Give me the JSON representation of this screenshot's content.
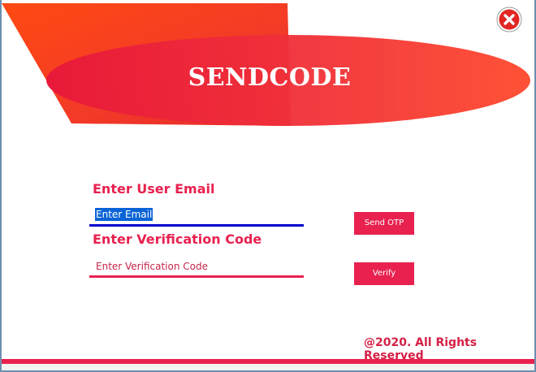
{
  "window": {
    "title": "SENDCODE",
    "close_icon": "close-icon"
  },
  "form": {
    "email_label": "Enter User Email",
    "email_placeholder": "Enter Email",
    "email_selected_text": "Enter Email",
    "code_label": "Enter Verification Code",
    "code_placeholder": "Enter Verification Code",
    "send_otp_label": "Send OTP",
    "verify_label": "Verify"
  },
  "footer": {
    "copyright": "@2020. All Rights Reserved"
  },
  "colors": {
    "accent": "#e8214f",
    "header_red": "#f03a2a",
    "email_underline": "#0000cc",
    "selection": "#0a64d6"
  }
}
